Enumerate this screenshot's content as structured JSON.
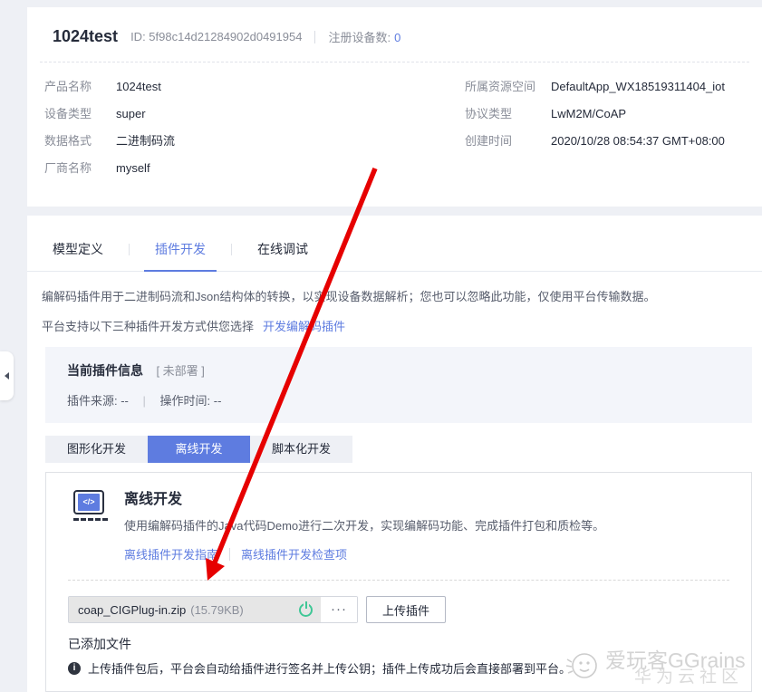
{
  "colors": {
    "accent_blue": "#5e7ce0",
    "success_green": "#3fc796",
    "arrow_red": "#e60000"
  },
  "header": {
    "title": "1024test",
    "id_text": "ID: 5f98c14d21284902d0491954",
    "device_count_label": "注册设备数:",
    "device_count_value": "0"
  },
  "product_info": {
    "left": [
      {
        "label": "产品名称",
        "value": "1024test"
      },
      {
        "label": "设备类型",
        "value": "super"
      },
      {
        "label": "数据格式",
        "value": "二进制码流"
      },
      {
        "label": "厂商名称",
        "value": "myself"
      }
    ],
    "right": [
      {
        "label": "所属资源空间",
        "value": "DefaultApp_WX18519311404_iot"
      },
      {
        "label": "协议类型",
        "value": "LwM2M/CoAP"
      },
      {
        "label": "创建时间",
        "value": "2020/10/28 08:54:37 GMT+08:00"
      }
    ]
  },
  "tabs": [
    {
      "label": "模型定义"
    },
    {
      "label": "插件开发"
    },
    {
      "label": "在线调试"
    }
  ],
  "plugin": {
    "intro_line1": "编解码插件用于二进制码流和Json结构体的转换，以实现设备数据解析；您也可以忽略此功能，仅使用平台传输数据。",
    "intro_line2": "平台支持以下三种插件开发方式供您选择",
    "intro_link": "开发编解码插件",
    "current": {
      "title": "当前插件信息",
      "status": "[ 未部署 ]",
      "source": "插件来源: --",
      "separator": "|",
      "time": "操作时间: --"
    },
    "modes": [
      {
        "label": "图形化开发"
      },
      {
        "label": "离线开发"
      },
      {
        "label": "脚本化开发"
      }
    ],
    "offline": {
      "icon_glyph": "</>",
      "title": "离线开发",
      "description": "使用编解码插件的Java代码Demo进行二次开发，实现编解码功能、完成插件打包和质检等。",
      "link1": "离线插件开发指南",
      "link2": "离线插件开发检查项",
      "file_name": "coap_CIGPlug-in.zip",
      "file_size": "(15.79KB)",
      "more_label": "···",
      "upload_button": "上传插件",
      "added_label": "已添加文件",
      "note_icon": "i",
      "note": "上传插件包后，平台会自动给插件进行签名并上传公钥；插件上传成功后会直接部署到平台。"
    }
  },
  "watermark": {
    "brand": "爱玩客GGrains",
    "community": "华为云社区"
  }
}
